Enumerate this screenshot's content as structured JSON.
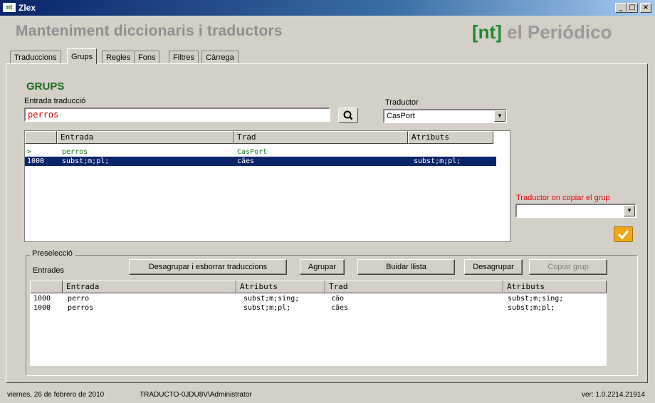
{
  "window": {
    "app_icon_text": "nt",
    "title": "Zlex",
    "controls": {
      "minimize": "_",
      "maximize": "□",
      "close": "×"
    }
  },
  "header": {
    "title": "Manteniment diccionaris i traductors",
    "brand_nt": "[nt]",
    "brand_name": "el Periódico",
    "brand_color": "#1d8a2e"
  },
  "tabs": [
    {
      "label": "Traduccions",
      "active": false
    },
    {
      "label": "Grups",
      "active": true
    },
    {
      "label": "Regles",
      "active": false
    },
    {
      "label": "Fons",
      "active": false
    },
    {
      "label": "Filtres",
      "active": false
    },
    {
      "label": "Càrrega",
      "active": false
    }
  ],
  "grups": {
    "title": "GRUPS",
    "entrada_label": "Entrada traducció",
    "entrada_value": "perros",
    "search_icon": "search-icon",
    "traductor_label": "Traductor",
    "traductor_value": "CasPort",
    "grid": {
      "headers": [
        "",
        "Entrada",
        "Trad",
        "Atributs"
      ],
      "rows": [
        {
          "id": ">",
          "entrada": "perros",
          "trad": "CasPort",
          "atributs": ""
        },
        {
          "id": "1000",
          "entrada": "subst;m;pl;",
          "trad": "cães",
          "atributs": "subst;m;pl;"
        }
      ]
    },
    "copiar_label": "Traductor on copiar el grup",
    "copiar_value": "",
    "ok_icon": "checkmark-icon"
  },
  "preseleccio": {
    "title": "Preselecció",
    "entrades_label": "Entrades",
    "buttons": {
      "desagrupar_esborrar": "Desagrupar i esborrar traduccions",
      "agrupar": "Agrupar",
      "buidar": "Buidar llista",
      "desagrupar": "Desagrupar",
      "copiar": "Copiar grup"
    },
    "grid": {
      "headers": [
        "",
        "Entrada",
        "Atributs",
        "Trad",
        "Atributs"
      ],
      "rows": [
        {
          "id": "1000",
          "entrada": "perro",
          "atributs": "subst;m;sing;",
          "trad": "cão",
          "atributs2": "subst;m;sing;"
        },
        {
          "id": "1000",
          "entrada": "perros",
          "atributs": "subst;m;pl;",
          "trad": "cães",
          "atributs2": "subst;m;pl;"
        }
      ]
    }
  },
  "status": {
    "date": "viernes, 26 de febrero de 2010",
    "user": "TRADUCTO-0JDU8V\\Administrator",
    "version": "ver: 1.0.2214.21914"
  }
}
